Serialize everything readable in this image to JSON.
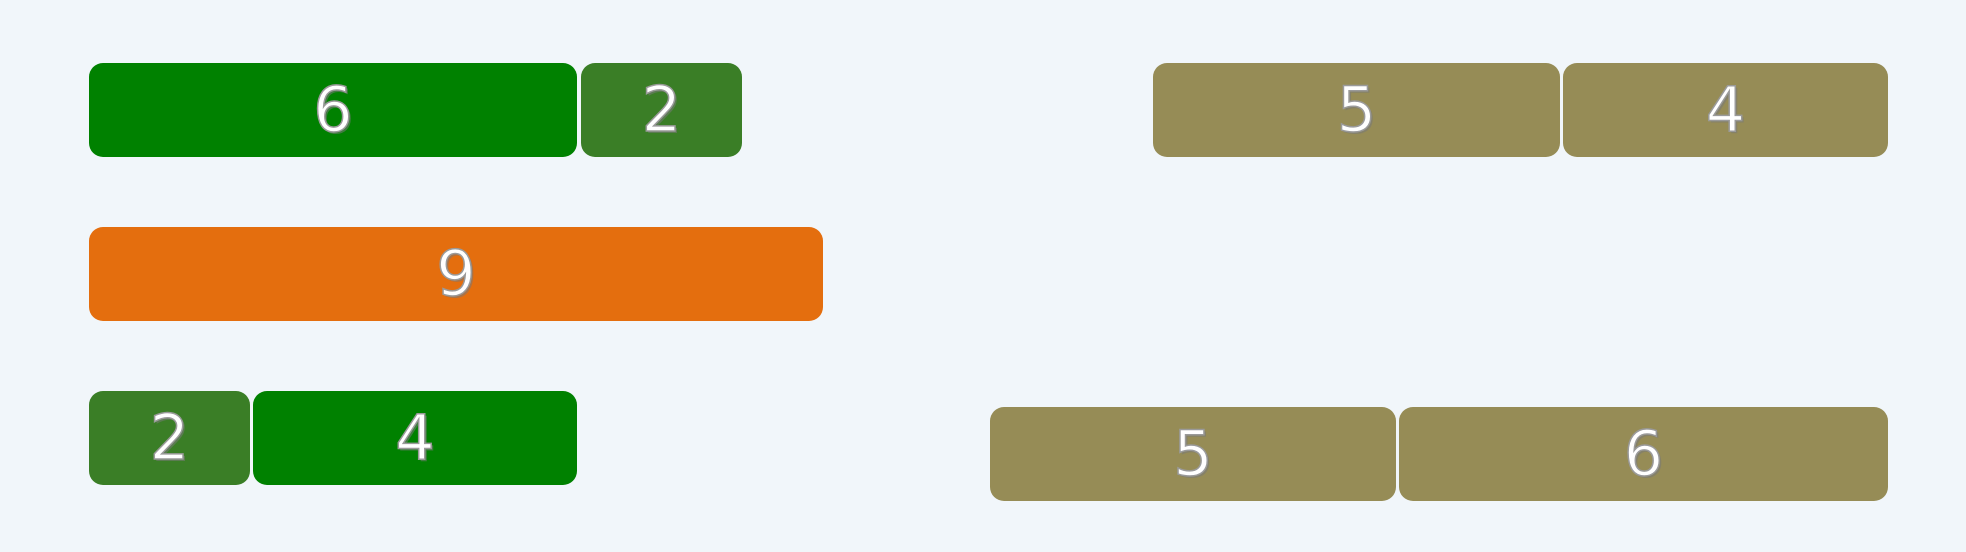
{
  "colors": {
    "background": "#f1f6fa",
    "dark_green": "#3a7e26",
    "green": "#008100",
    "orange": "#e46e0e",
    "olive": "#968c56"
  },
  "left_bars": [
    {
      "tiles": [
        {
          "value": "6",
          "color": "green"
        },
        {
          "value": "2",
          "color": "dark_green"
        }
      ]
    },
    {
      "tiles": [
        {
          "value": "9",
          "color": "orange"
        }
      ]
    },
    {
      "tiles": [
        {
          "value": "2",
          "color": "dark_green"
        },
        {
          "value": "4",
          "color": "green"
        }
      ]
    }
  ],
  "right_bars": [
    {
      "tiles": [
        {
          "value": "5",
          "color": "olive"
        },
        {
          "value": "4",
          "color": "olive"
        }
      ]
    },
    {
      "tiles": [
        {
          "value": "5",
          "color": "olive"
        },
        {
          "value": "6",
          "color": "olive"
        }
      ]
    }
  ]
}
